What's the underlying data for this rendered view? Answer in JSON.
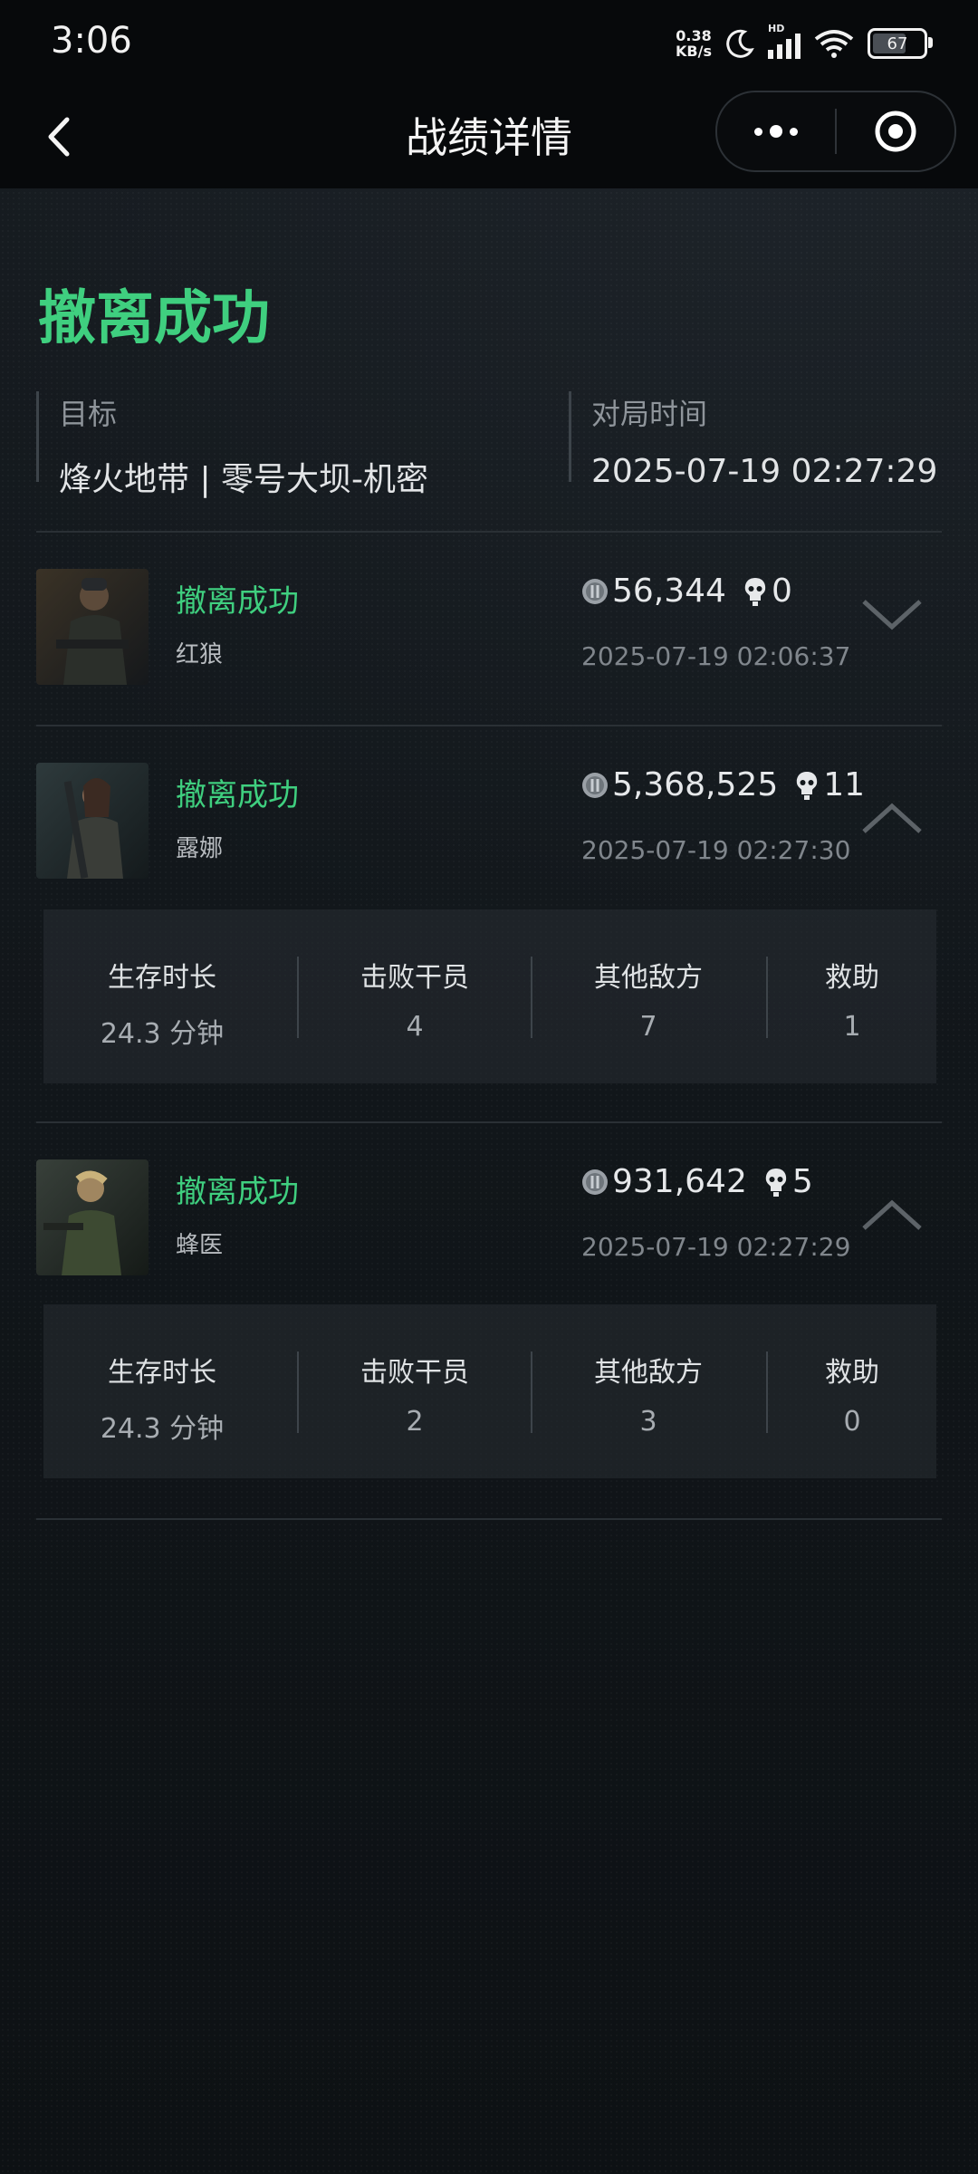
{
  "status_bar": {
    "time": "3:06",
    "net_speed_value": "0.38",
    "net_speed_unit": "KB/s",
    "signal_tag": "HD",
    "battery": "67",
    "battery_level": 0.67
  },
  "nav": {
    "title": "战绩详情"
  },
  "header": {
    "result": "撤离成功",
    "target_label": "目标",
    "target_value": "烽火地带 | 零号大坝-机密",
    "time_label": "对局时间",
    "time_value": "2025-07-19 02:27:29"
  },
  "players": [
    {
      "status": "撤离成功",
      "name": "红狼",
      "coins": "56,344",
      "kills": "0",
      "time": "2025-07-19 02:06:37",
      "expanded": false
    },
    {
      "status": "撤离成功",
      "name": "露娜",
      "coins": "5,368,525",
      "kills": "11",
      "time": "2025-07-19 02:27:30",
      "expanded": true,
      "details": [
        {
          "label": "生存时长",
          "value": "24.3 分钟"
        },
        {
          "label": "击败干员",
          "value": "4"
        },
        {
          "label": "其他敌方",
          "value": "7"
        },
        {
          "label": "救助",
          "value": "1"
        }
      ]
    },
    {
      "status": "撤离成功",
      "name": "蜂医",
      "coins": "931,642",
      "kills": "5",
      "time": "2025-07-19 02:27:29",
      "expanded": true,
      "details": [
        {
          "label": "生存时长",
          "value": "24.3 分钟"
        },
        {
          "label": "击败干员",
          "value": "2"
        },
        {
          "label": "其他敌方",
          "value": "3"
        },
        {
          "label": "救助",
          "value": "0"
        }
      ]
    }
  ],
  "colors": {
    "accent_green": "#3fcf7f",
    "background": "#12171b"
  },
  "icons": [
    "back-arrow-icon",
    "more-dots-icon",
    "target-icon",
    "coin-icon",
    "skull-icon",
    "chevron-down-icon",
    "chevron-up-icon"
  ]
}
